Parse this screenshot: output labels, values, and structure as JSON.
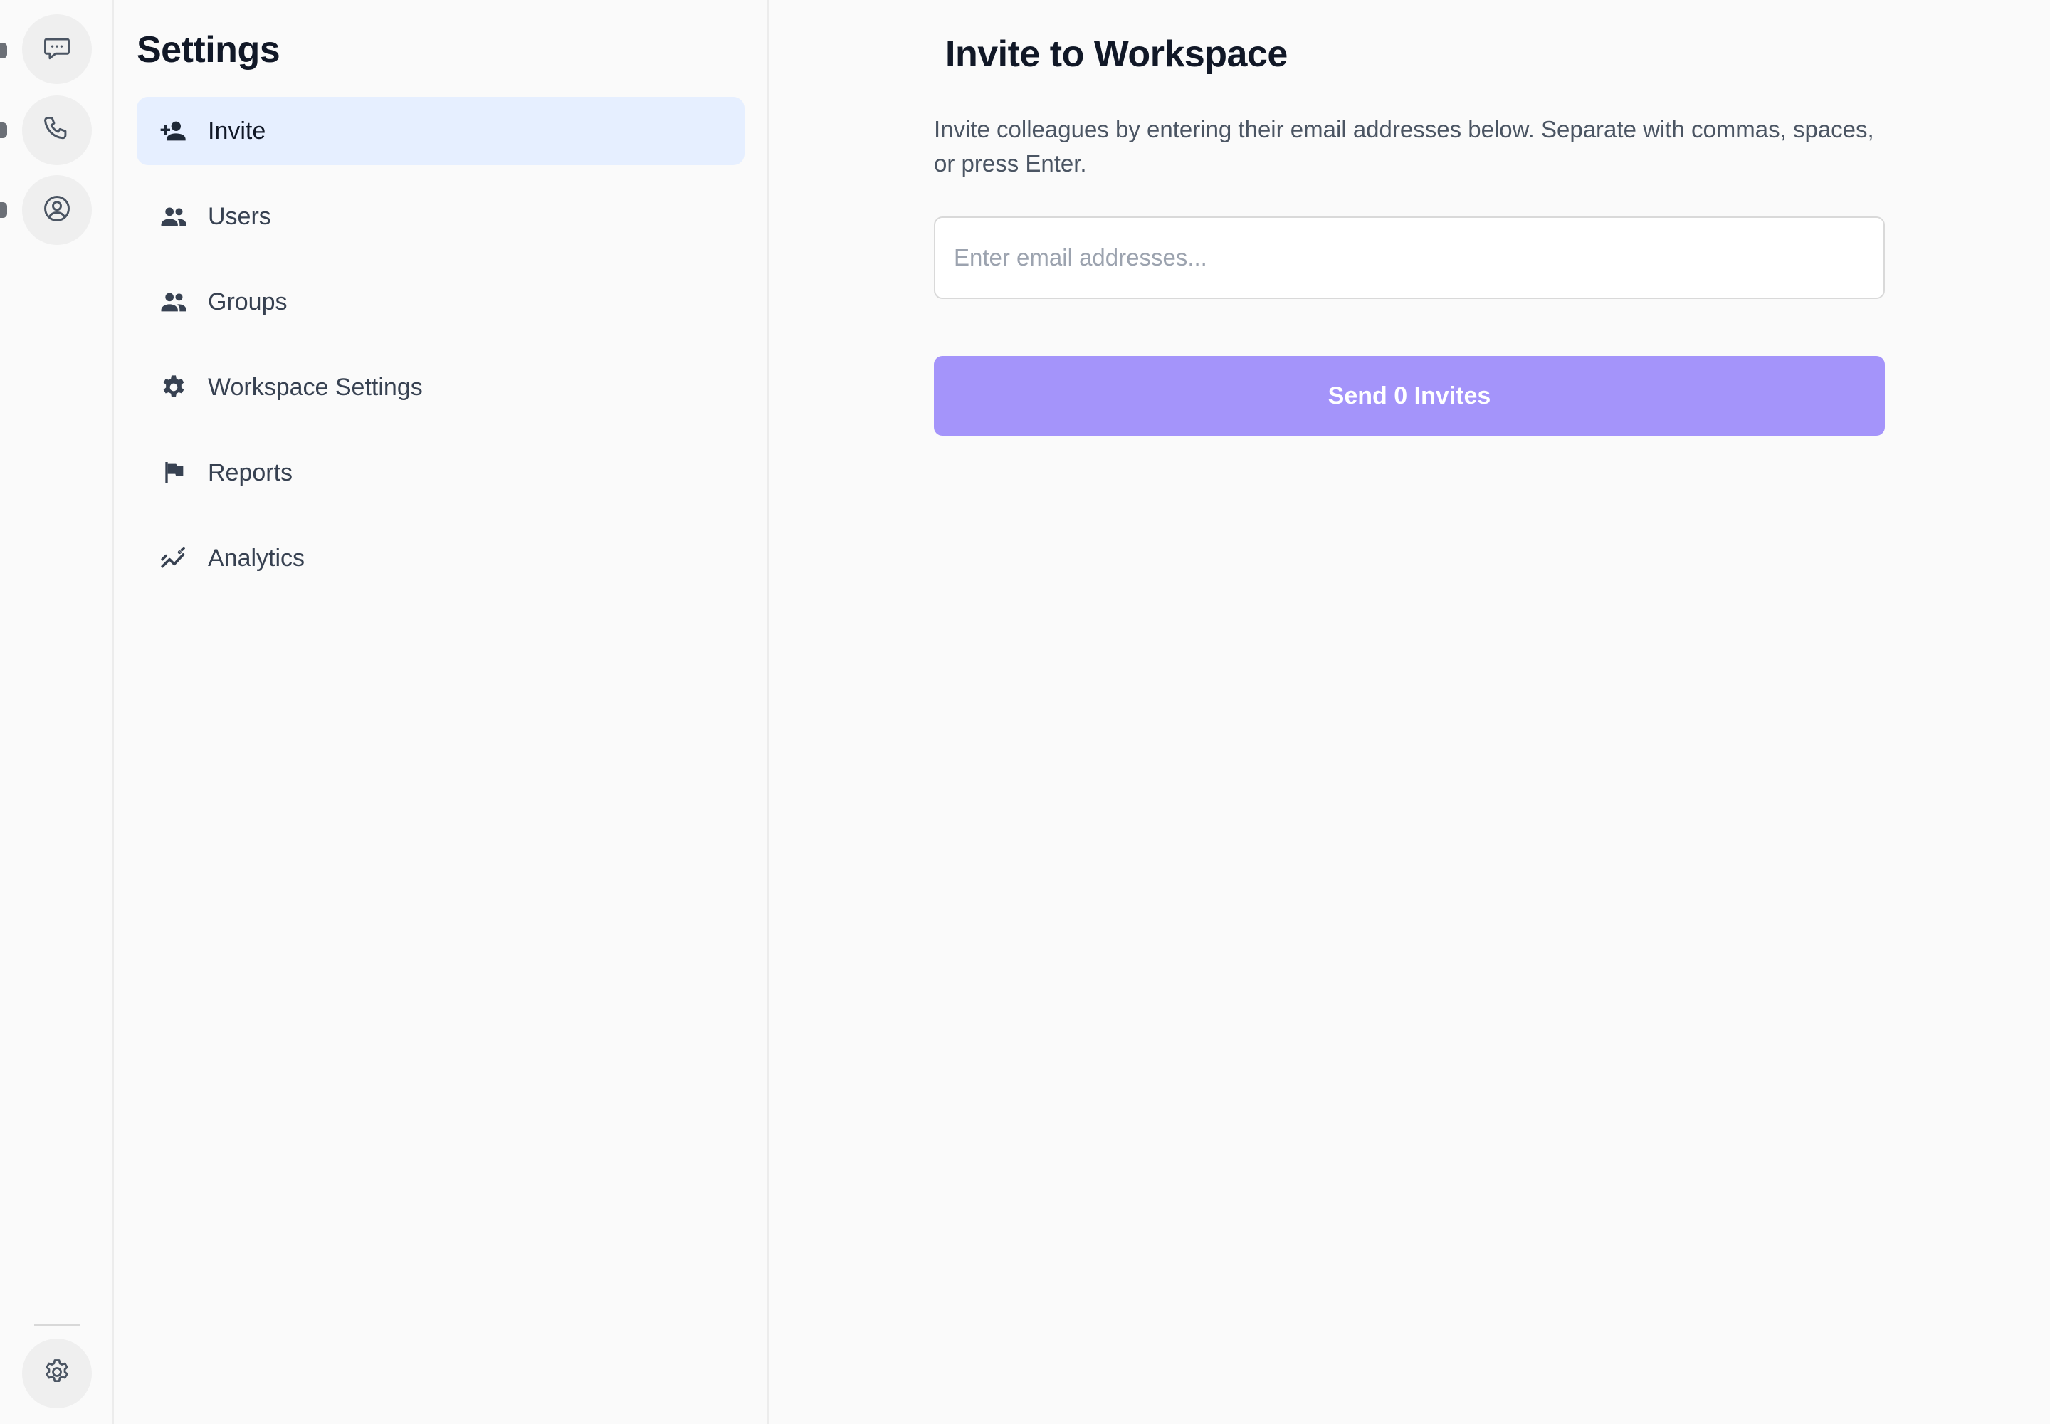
{
  "rail": {
    "items": [
      {
        "icon": "chat-icon"
      },
      {
        "icon": "phone-icon"
      },
      {
        "icon": "user-circle-icon"
      }
    ],
    "bottom": {
      "icon": "gear-icon"
    }
  },
  "sidebar": {
    "title": "Settings",
    "items": [
      {
        "label": "Invite",
        "icon": "person-add-icon",
        "active": true
      },
      {
        "label": "Users",
        "icon": "people-icon",
        "active": false
      },
      {
        "label": "Groups",
        "icon": "people-icon",
        "active": false
      },
      {
        "label": "Workspace Settings",
        "icon": "cog-icon",
        "active": false
      },
      {
        "label": "Reports",
        "icon": "flag-icon",
        "active": false
      },
      {
        "label": "Analytics",
        "icon": "trending-icon",
        "active": false
      }
    ]
  },
  "main": {
    "title": "Invite to Workspace",
    "description": "Invite colleagues by entering their email addresses below. Separate with commas, spaces, or press Enter.",
    "email_input": {
      "placeholder": "Enter email addresses...",
      "value": ""
    },
    "send_button_label": "Send 0 Invites"
  },
  "colors": {
    "accent": "#a494fa",
    "active_nav_bg": "#e6efff",
    "background": "#fafafa"
  }
}
